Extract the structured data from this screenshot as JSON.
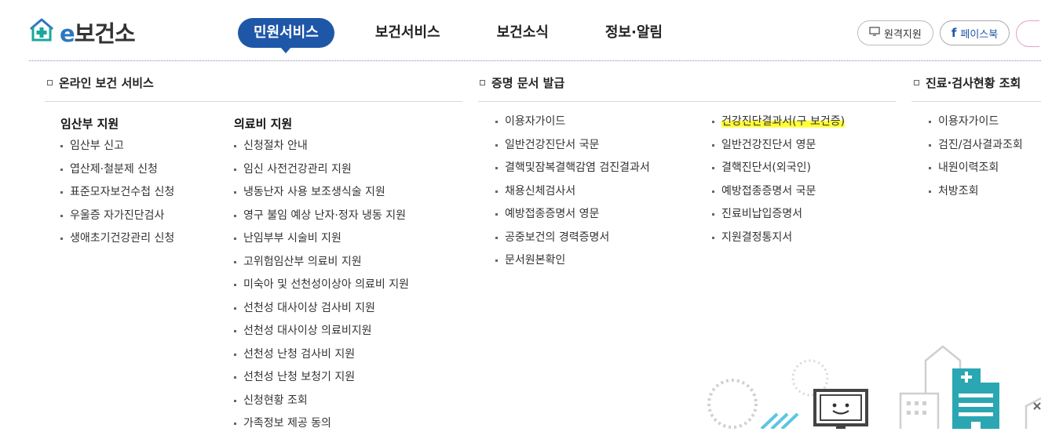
{
  "header": {
    "logo_prefix": "e",
    "logo_suffix": "보건소",
    "nav": [
      "민원서비스",
      "보건서비스",
      "보건소식",
      "정보·알림"
    ],
    "util": {
      "remote": "원격지원",
      "facebook": "페이스북"
    }
  },
  "sections": {
    "online": {
      "title": "온라인 보건 서비스",
      "col1": {
        "head": "임산부 지원",
        "items": [
          "임산부 신고",
          "엽산제·철분제 신청",
          "표준모자보건수첩 신청",
          "우울증 자가진단검사",
          "생애초기건강관리 신청"
        ]
      },
      "col2": {
        "head": "의료비 지원",
        "items": [
          "신청절차 안내",
          "임신 사전건강관리 지원",
          "냉동난자 사용 보조생식술 지원",
          "영구 불임 예상 난자·정자 냉동 지원",
          "난임부부 시술비 지원",
          "고위험임산부 의료비 지원",
          "미숙아 및 선천성이상아 의료비 지원",
          "선천성 대사이상 검사비 지원",
          "선천성 대사이상 의료비지원",
          "선천성 난청 검사비 지원",
          "선천성 난청 보청기 지원",
          "신청현황 조회",
          "가족정보 제공 동의"
        ]
      }
    },
    "cert": {
      "title": "증명 문서 발급",
      "col1": {
        "items": [
          "이용자가이드",
          "일반건강진단서 국문",
          "결핵및잠복결핵감염 검진결과서",
          "채용신체검사서",
          "예방접종증명서 영문",
          "공중보건의 경력증명서",
          "문서원본확인"
        ]
      },
      "col2": {
        "items": [
          "건강진단결과서(구 보건증)",
          "일반건강진단서 영문",
          "결핵진단서(외국인)",
          "예방접종증명서 국문",
          "진료비납입증명서",
          "지원결정통지서"
        ]
      }
    },
    "clinic": {
      "title": "진료·검사현황 조회",
      "col1": {
        "items": [
          "이용자가이드",
          "검진/검사결과조회",
          "내원이력조회",
          "처방조회"
        ]
      }
    }
  },
  "colors": {
    "brand": "#1f57a8",
    "logo_accent": "#2b78c0",
    "highlight": "#ffff33"
  }
}
